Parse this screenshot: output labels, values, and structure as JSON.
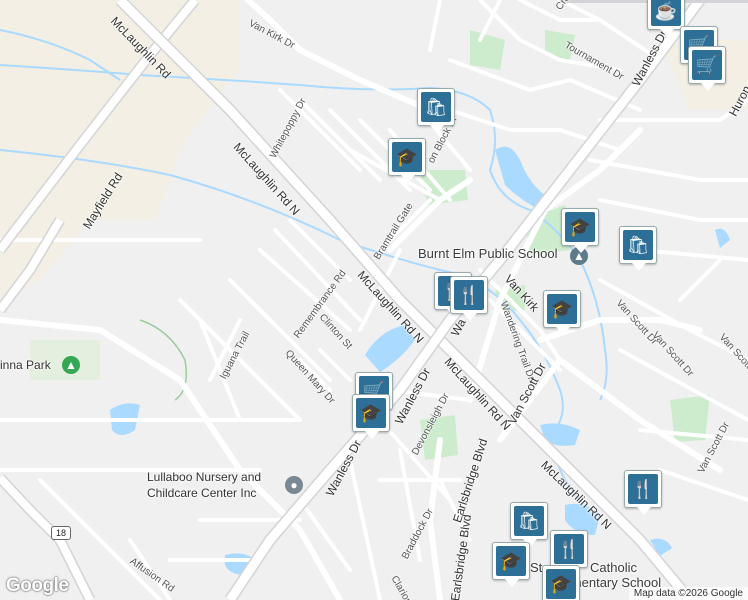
{
  "roads": {
    "mclaughlin_1": "McLaughlin Rd",
    "mclaughlin_2": "McLaughlin Rd N",
    "mclaughlin_3": "McLaughlin Rd N",
    "mclaughlin_4": "McLaughlin Rd N",
    "mclaughlin_5": "McLaughlin Rd N",
    "mayfield": "Mayfield Rd",
    "van_kirk_top": "Van Kirk Dr",
    "van_kirk_mid": "Van Kirk",
    "whitepoppy": "Whitepoppy Dr",
    "bramtrail": "Bramtrail Gate",
    "remembrance": "Remembrance Rd",
    "clinton": "Clinton St",
    "queen_mary": "Queen Mary Dr",
    "iguana": "Iguana Trail",
    "wanless_1": "Wanless Dr",
    "wanless_2": "Wanless Dr",
    "wanless_top": "Wanless Dr",
    "wan_short": "Wa",
    "wandering": "Wandering Trail Dr",
    "van_scott_1": "Van Scott Dr",
    "van_scott_2": "Van Scott Dr",
    "van_scott_3": "Van Scott Dr",
    "van_scott_4": "Van Scott Dr",
    "van_scott_5": "Van Scott Dr",
    "devonsleigh": "Devonsleigh Dr",
    "earlsbridge_1": "Earlsbridge Blvd",
    "earlsbridge_2": "Earlsbridge Blvd",
    "braddock": "Braddock Dr",
    "affusion": "Affusion Rd",
    "tournament": "Tournament Dr",
    "cres": "Cres",
    "clarion": "Clarion",
    "brin_block": "on Block Dr",
    "huron": "Huron",
    "route": "18"
  },
  "places": {
    "burnt_elm": "Burnt Elm Public School",
    "nursery_1": "Lullaboo Nursery and",
    "nursery_2": "Childcare Center Inc",
    "park": "inna Park",
    "catholic_1": "Catholic",
    "catholic_2": "Elementary School",
    "catholic_prefix": "St."
  },
  "icons": {
    "pins": [
      "coffee-icon",
      "shopping-cart-icon",
      "shopping-cart-icon",
      "shopping-bag-icon",
      "graduation-cap-icon",
      "graduation-cap-icon",
      "shopping-bag-icon",
      "restaurant-icon",
      "graduation-cap-icon",
      "shopping-cart-icon",
      "graduation-cap-icon",
      "restaurant-icon",
      "shopping-bag-icon",
      "restaurant-icon",
      "graduation-cap-icon",
      "graduation-cap-icon"
    ],
    "pin_color": "#2d6f96",
    "park_color": "#34a853",
    "school_color": "#5e7b8c"
  },
  "footer": {
    "logo": "Google",
    "attribution": "Map data ©2026 Google"
  }
}
